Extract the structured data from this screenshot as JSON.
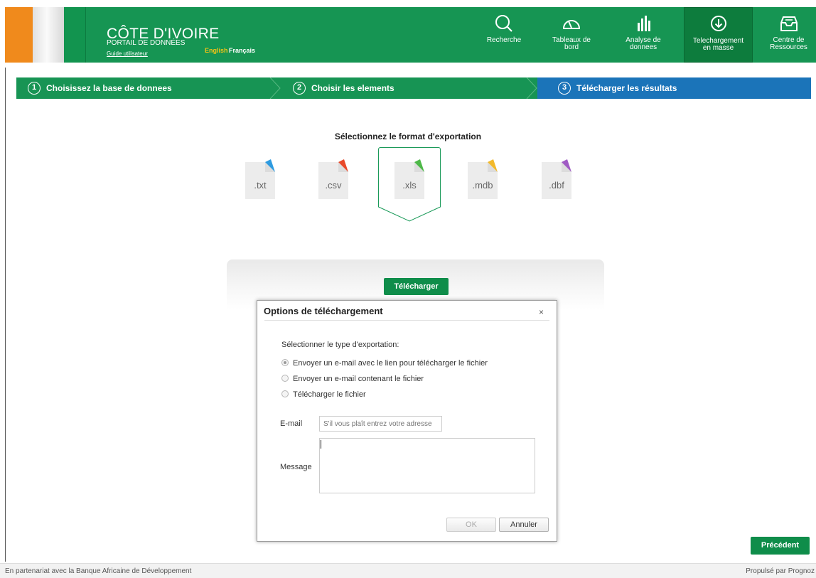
{
  "header": {
    "title": "CÔTE D'IVOIRE",
    "subtitle": "PORTAIL DE DONNÉES",
    "guide": "Guide utilisateur",
    "lang_english": "English",
    "lang_french": "Français",
    "nav": [
      {
        "label1": "Recherche",
        "label2": "",
        "icon": "search-icon"
      },
      {
        "label1": "Tableaux de",
        "label2": "bord",
        "icon": "gauge-icon"
      },
      {
        "label1": "Analyse de",
        "label2": "donnees",
        "icon": "bar-chart-icon"
      },
      {
        "label1": "Telechargement",
        "label2": "en masse",
        "icon": "download-icon",
        "active": true
      },
      {
        "label1": "Centre de",
        "label2": "Ressources",
        "icon": "inbox-icon"
      }
    ]
  },
  "steps": [
    {
      "num": "1",
      "label": "Choisissez la base de donnees"
    },
    {
      "num": "2",
      "label": "Choisir les elements"
    },
    {
      "num": "3",
      "label": "Télécharger les résultats",
      "active": true
    }
  ],
  "format_title": "Sélectionnez le format d'exportation",
  "formats": [
    {
      "ext": ".txt",
      "color": "#2e9be0"
    },
    {
      "ext": ".csv",
      "color": "#e8492a"
    },
    {
      "ext": ".xls",
      "color": "#4db848",
      "selected": true
    },
    {
      "ext": ".mdb",
      "color": "#f2b92b"
    },
    {
      "ext": ".dbf",
      "color": "#a05bc4"
    }
  ],
  "download_button": "Télécharger",
  "dialog": {
    "title": "Options de téléchargement",
    "close": "×",
    "instruction": "Sélectionner le type d'exportation:",
    "options": [
      {
        "label": "Envoyer un e-mail avec le lien pour télécharger le fichier",
        "checked": true
      },
      {
        "label": "Envoyer un e-mail contenant le fichier",
        "checked": false
      },
      {
        "label": "Télécharger le fichier",
        "checked": false
      }
    ],
    "email_label": "E-mail",
    "email_placeholder": "S'il vous plaît entrez votre adresse",
    "email_value": "",
    "message_label": "Message",
    "message_value": "",
    "ok": "OK",
    "cancel": "Annuler"
  },
  "previous_button": "Précédent",
  "footer": {
    "left": "En partenariat avec la Banque Africaine de Développement",
    "right": "Propulsé par Prognoz"
  },
  "colors": {
    "brand_green": "#169553",
    "active_step_blue": "#1b74b9",
    "lang_highlight": "#f3c316"
  }
}
